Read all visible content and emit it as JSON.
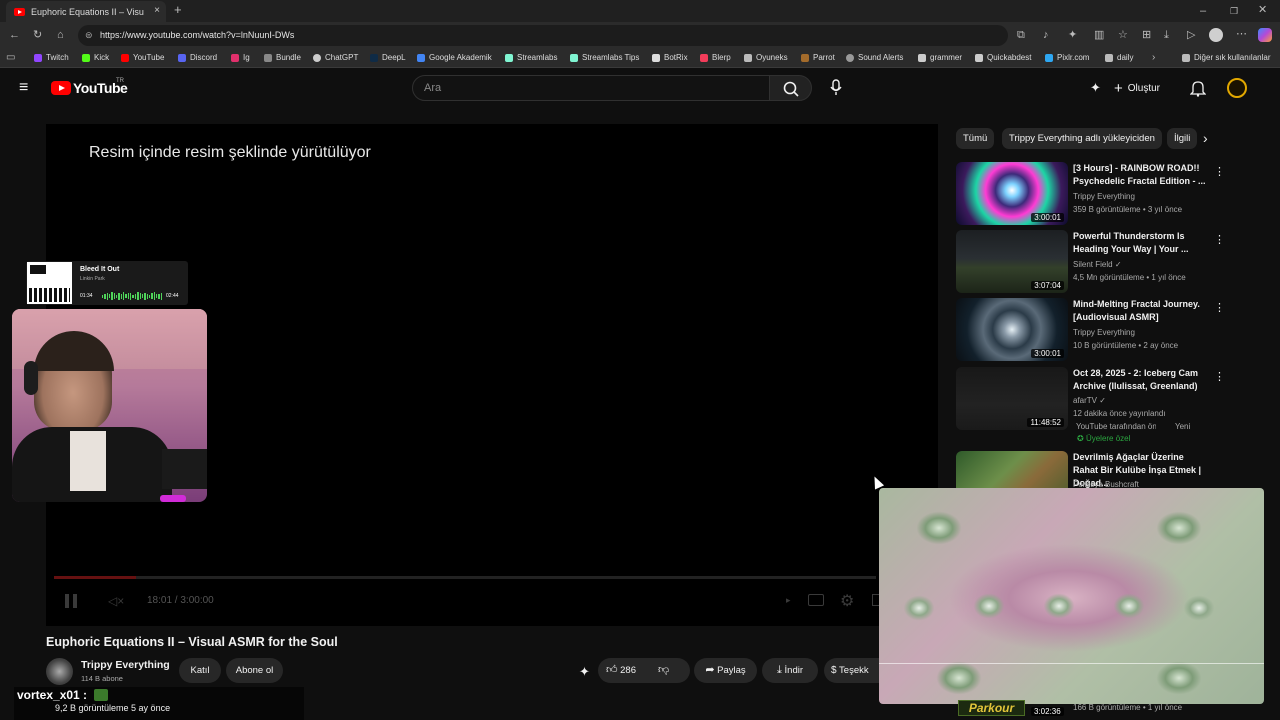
{
  "browser": {
    "tab_title": "Euphoric Equations II – Visu",
    "url": "https://www.youtube.com/watch?v=lnNuunI-DWs",
    "bookmarks": [
      "Twitch",
      "Kick",
      "YouTube",
      "Discord",
      "Ig",
      "Bundle",
      "ChatGPT",
      "DeepL",
      "Google Akademik",
      "Streamlabs",
      "Streamlabs Tips",
      "BotRix",
      "Blerp",
      "Oyuneks",
      "Parrot",
      "Sound Alerts",
      "grammer",
      "Quickabdest",
      "Pixlr.com",
      "daily"
    ],
    "bookmarks_other": "Diğer sık kullanılanlar"
  },
  "header": {
    "logo": "YouTube",
    "region": "TR",
    "search_placeholder": "Ara",
    "create_label": "Oluştur"
  },
  "player": {
    "pip_message": "Resim içinde resim şeklinde yürütülüyor",
    "time": "18:01 / 3:00:00",
    "progress_fraction": 0.1
  },
  "overlay": {
    "now_playing_title": "Bleed It Out",
    "now_playing_artist": "Linkin Park",
    "elapsed": "01:34",
    "total": "02:44",
    "chat_user": "vortex_x01 :",
    "pip_badge": "Parkour"
  },
  "video": {
    "title": "Euphoric Equations II – Visual ASMR for the Soul",
    "channel": "Trippy Everything",
    "subscribers": "114 B abone",
    "join_label": "Katıl",
    "subscribe_label": "Abone ol",
    "likes": "286",
    "share_label": "Paylaş",
    "download_label": "İndir",
    "thanks_label": "Teşekk",
    "views": "9,2 B görüntüleme  5 ay önce"
  },
  "sidebar": {
    "chips": [
      "Tümü",
      "Trippy Everything adlı yükleyiciden",
      "İlgili"
    ],
    "recs": [
      {
        "title": "[3 Hours] - RAINBOW ROAD!! Psychedelic Fractal Edition - ...",
        "channel": "Trippy Everything",
        "meta": "359 B görüntüleme • 3 yıl önce",
        "duration": "3:00:01"
      },
      {
        "title": "Powerful Thunderstorm Is Heading Your Way | Your ...",
        "channel": "Silent Field",
        "meta": "4,5 Mn görüntüleme • 1 yıl önce",
        "duration": "3:07:04"
      },
      {
        "title": "Mind-Melting Fractal Journey. [Audiovisual ASMR]",
        "channel": "Trippy Everything",
        "meta": "10 B görüntüleme • 2 ay önce",
        "duration": "3:00:01"
      },
      {
        "title": "Oct 28, 2025 - 2: Iceberg Cam Archive (Ilulissat, Greenland)",
        "channel": "afarTV",
        "meta": "12 dakika önce yayınlandı",
        "meta2": "YouTube tarafından öne...",
        "new_badge": "Yeni",
        "members": "Üyelere özel",
        "duration": "11:48:52"
      },
      {
        "title": "Devrilmiş Ağaçlar Üzerine Rahat Bir Kulübe İnşa Etmek | Doğad...",
        "channel": "Polissya Bushcraft",
        "duration": ""
      }
    ],
    "last_rec": {
      "meta": "166 B görüntüleme • 1 yıl önce",
      "duration": "3:02:36"
    }
  },
  "colors": {
    "brand": "#ff0000",
    "background": "#0f0f0f",
    "accent_verified": "#aaaaaa",
    "members_green": "#2ba640"
  }
}
